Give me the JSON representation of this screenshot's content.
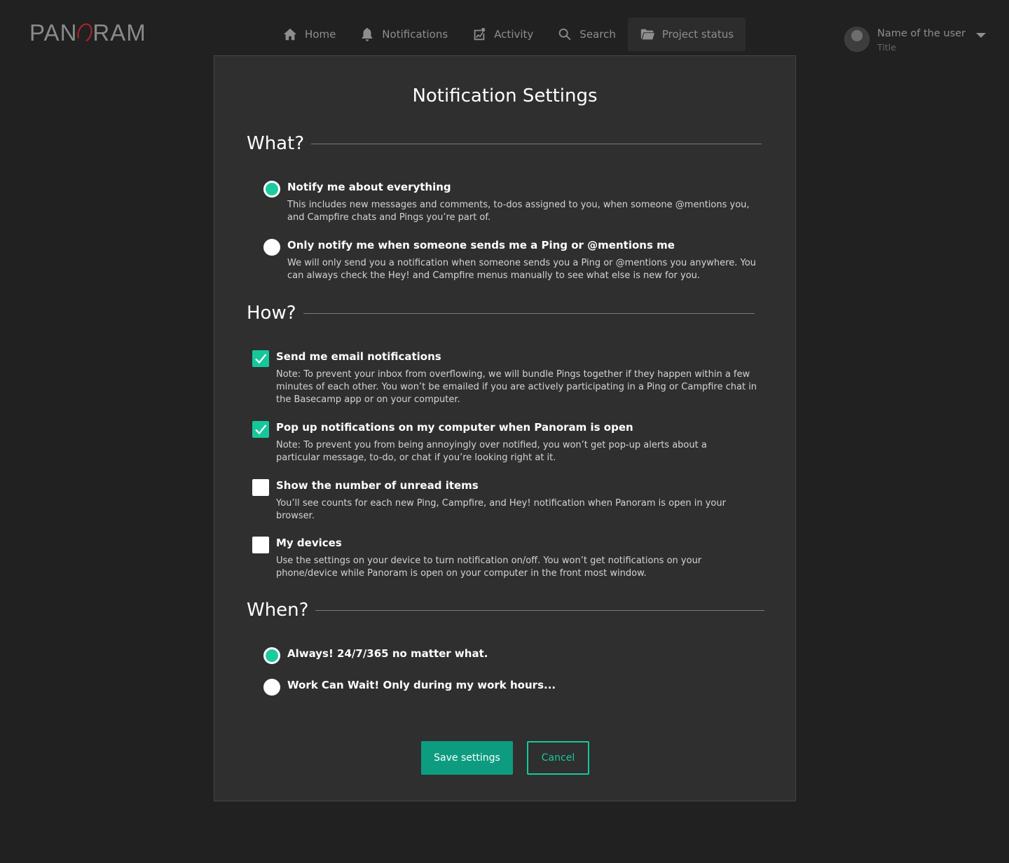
{
  "logo": {
    "text_left": "PAN",
    "text_right": "RAM"
  },
  "nav": [
    {
      "label": "Home",
      "icon": "home-icon"
    },
    {
      "label": "Notifications",
      "icon": "bell-icon"
    },
    {
      "label": "Activity",
      "icon": "activity-icon"
    },
    {
      "label": "Search",
      "icon": "search-icon"
    },
    {
      "label": "Project status",
      "icon": "folder-icon",
      "active": true
    }
  ],
  "user": {
    "name": "Name of the user",
    "title": "Title"
  },
  "panel": {
    "title": "Notification Settings",
    "what": {
      "heading": "What?",
      "options": [
        {
          "title": "Notify me about everything",
          "desc": "This includes new messages and comments, to-dos assigned to you, when someone @mentions you, and Campfire chats and Pings you’re part of.",
          "selected": true
        },
        {
          "title": "Only notify me when someone sends me a Ping or @mentions me",
          "desc": "We will only send you a notification when someone sends you a Ping or @mentions you anywhere. You can always check the Hey! and Campfire menus manually to see what else is new for you.",
          "selected": false
        }
      ]
    },
    "how": {
      "heading": "How?",
      "options": [
        {
          "title": "Send me email notifications",
          "desc": "Note: To prevent your inbox from overflowing, we will bundle Pings together if they happen within a few minutes of each other. You won’t be emailed if you are actively participating in a Ping or Campfire chat in the Basecamp app or on your computer.",
          "checked": true
        },
        {
          "title": "Pop up notifications on my computer when Panoram is open",
          "desc": "Note: To prevent you from being annoyingly over notified, you won’t get pop-up alerts about a particular message, to-do, or chat if you’re looking right at it.",
          "checked": true
        },
        {
          "title": "Show the number of unread items",
          "desc": "You’ll see counts for each new Ping, Campfire, and Hey! notification when Panoram is open in your browser.",
          "checked": false
        },
        {
          "title": "My devices",
          "desc": "Use the settings on your device to turn notification on/off. You won’t get notifications on your phone/device while Panoram is open on your computer in the front most window.",
          "checked": false
        }
      ]
    },
    "when": {
      "heading": "When?",
      "options": [
        {
          "title": "Always! 24/7/365 no matter what.",
          "selected": true
        },
        {
          "title": "Work Can Wait! Only during my work hours...",
          "selected": false
        }
      ]
    },
    "save_label": "Save settings",
    "cancel_label": "Cancel"
  },
  "colors": {
    "accent": "#17c79c",
    "background": "#212121",
    "panel": "#2f2f2f",
    "brand_red": "#b3242b"
  }
}
